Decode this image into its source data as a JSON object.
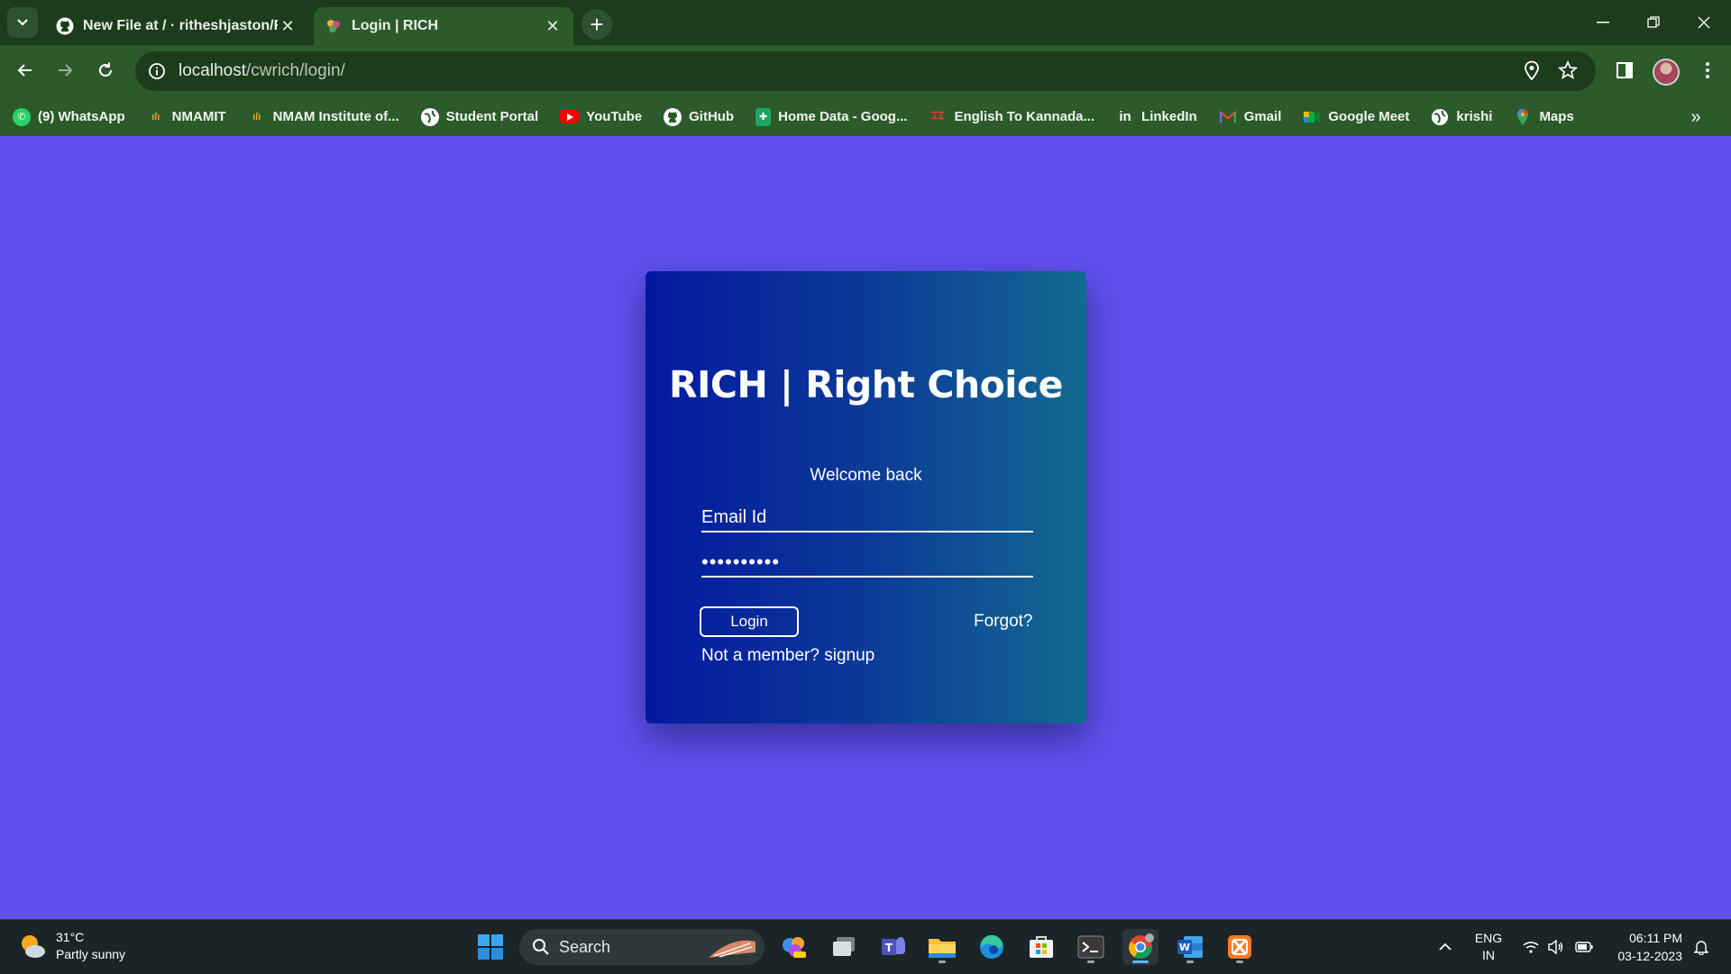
{
  "browser": {
    "tabs": [
      {
        "title": "New File at / · ritheshjaston/Ri",
        "icon": "github-icon",
        "active": false
      },
      {
        "title": "Login | RICH",
        "icon": "rich-favicon",
        "active": true
      }
    ],
    "url_host": "localhost",
    "url_path": "/cwrich/login/",
    "bookmarks": [
      {
        "label": "(9) WhatsApp",
        "icon": "whatsapp-icon"
      },
      {
        "label": "NMAMIT",
        "icon": "nmamit-icon"
      },
      {
        "label": "NMAM Institute of...",
        "icon": "nmamit-icon"
      },
      {
        "label": "Student Portal",
        "icon": "globe-icon"
      },
      {
        "label": "YouTube",
        "icon": "youtube-icon"
      },
      {
        "label": "GitHub",
        "icon": "github-icon"
      },
      {
        "label": "Home Data - Goog...",
        "icon": "sheets-icon"
      },
      {
        "label": "English To Kannada...",
        "icon": "translate-icon"
      },
      {
        "label": "LinkedIn",
        "icon": "linkedin-icon"
      },
      {
        "label": "Gmail",
        "icon": "gmail-icon"
      },
      {
        "label": "Google Meet",
        "icon": "meet-icon"
      },
      {
        "label": "krishi",
        "icon": "globe-icon"
      },
      {
        "label": "Maps",
        "icon": "maps-icon"
      }
    ]
  },
  "page": {
    "heading": "RICH | Right Choice",
    "welcome": "Welcome back",
    "email_placeholder": "Email Id",
    "password_value": "••••••••••",
    "login_label": "Login",
    "forgot_label": "Forgot?",
    "signup_label": "Not a member? signup"
  },
  "taskbar": {
    "weather_temp": "31°C",
    "weather_desc": "Partly sunny",
    "search_label": "Search",
    "lang_top": "ENG",
    "lang_bottom": "IN",
    "time": "06:11 PM",
    "date": "03-12-2023"
  },
  "colors": {
    "page_background": "#6051ef",
    "browser_frame": "#2d5a2b",
    "card_gradient_start": "#0418a0",
    "card_gradient_end": "#136a92"
  }
}
